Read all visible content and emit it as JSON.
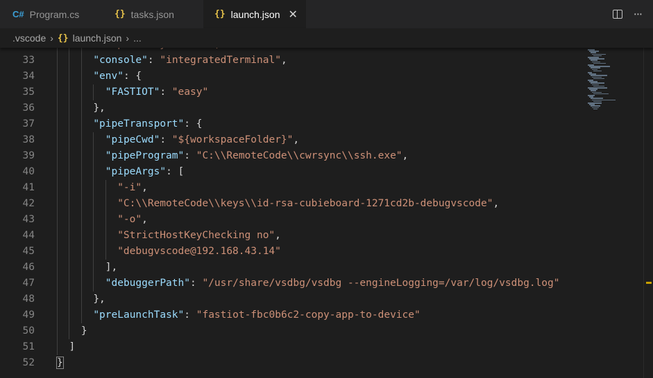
{
  "tabs": [
    {
      "label": "Program.cs",
      "icon": "C#",
      "icon_name": "csharp-file-icon",
      "active": false
    },
    {
      "label": "tasks.json",
      "icon": "{}",
      "icon_name": "json-file-icon",
      "active": false
    },
    {
      "label": "launch.json",
      "icon": "{}",
      "icon_name": "json-file-icon",
      "active": true
    }
  ],
  "tab_close": "✕",
  "tab_more": "···",
  "breadcrumb": {
    "folder": ".vscode",
    "file_icon": "{}",
    "file": "launch.json",
    "more": "..."
  },
  "colors": {
    "key": "#9cdcfe",
    "string": "#ce9178",
    "punct": "#d4d4d4",
    "background": "#1e1e1e"
  },
  "lines": [
    {
      "n": "32",
      "indent": 3,
      "tokens": [
        {
          "t": "s",
          "v": "\"stopAtEntry\": false,"
        }
      ]
    },
    {
      "n": "33",
      "indent": 3,
      "tokens": [
        {
          "t": "k",
          "v": "\"console\""
        },
        {
          "t": "p",
          "v": ": "
        },
        {
          "t": "s",
          "v": "\"integratedTerminal\""
        },
        {
          "t": "p",
          "v": ","
        }
      ]
    },
    {
      "n": "34",
      "indent": 3,
      "tokens": [
        {
          "t": "k",
          "v": "\"env\""
        },
        {
          "t": "p",
          "v": ": {"
        }
      ]
    },
    {
      "n": "35",
      "indent": 4,
      "tokens": [
        {
          "t": "k",
          "v": "\"FASTIOT\""
        },
        {
          "t": "p",
          "v": ": "
        },
        {
          "t": "s",
          "v": "\"easy\""
        }
      ]
    },
    {
      "n": "36",
      "indent": 3,
      "tokens": [
        {
          "t": "p",
          "v": "},"
        }
      ]
    },
    {
      "n": "37",
      "indent": 3,
      "tokens": [
        {
          "t": "k",
          "v": "\"pipeTransport\""
        },
        {
          "t": "p",
          "v": ": {"
        }
      ]
    },
    {
      "n": "38",
      "indent": 4,
      "tokens": [
        {
          "t": "k",
          "v": "\"pipeCwd\""
        },
        {
          "t": "p",
          "v": ": "
        },
        {
          "t": "s",
          "v": "\"${workspaceFolder}\""
        },
        {
          "t": "p",
          "v": ","
        }
      ]
    },
    {
      "n": "39",
      "indent": 4,
      "tokens": [
        {
          "t": "k",
          "v": "\"pipeProgram\""
        },
        {
          "t": "p",
          "v": ": "
        },
        {
          "t": "s",
          "v": "\"C:\\\\RemoteCode\\\\cwrsync\\\\ssh.exe\""
        },
        {
          "t": "p",
          "v": ","
        }
      ]
    },
    {
      "n": "40",
      "indent": 4,
      "tokens": [
        {
          "t": "k",
          "v": "\"pipeArgs\""
        },
        {
          "t": "p",
          "v": ": ["
        }
      ]
    },
    {
      "n": "41",
      "indent": 5,
      "tokens": [
        {
          "t": "s",
          "v": "\"-i\""
        },
        {
          "t": "p",
          "v": ","
        }
      ]
    },
    {
      "n": "42",
      "indent": 5,
      "tokens": [
        {
          "t": "s",
          "v": "\"C:\\\\RemoteCode\\\\keys\\\\id-rsa-cubieboard-1271cd2b-debugvscode\""
        },
        {
          "t": "p",
          "v": ","
        }
      ]
    },
    {
      "n": "43",
      "indent": 5,
      "tokens": [
        {
          "t": "s",
          "v": "\"-o\""
        },
        {
          "t": "p",
          "v": ","
        }
      ]
    },
    {
      "n": "44",
      "indent": 5,
      "tokens": [
        {
          "t": "s",
          "v": "\"StrictHostKeyChecking no\""
        },
        {
          "t": "p",
          "v": ","
        }
      ]
    },
    {
      "n": "45",
      "indent": 5,
      "tokens": [
        {
          "t": "s",
          "v": "\"debugvscode@192.168.43.14\""
        }
      ]
    },
    {
      "n": "46",
      "indent": 4,
      "tokens": [
        {
          "t": "p",
          "v": "],"
        }
      ]
    },
    {
      "n": "47",
      "indent": 4,
      "tokens": [
        {
          "t": "k",
          "v": "\"debuggerPath\""
        },
        {
          "t": "p",
          "v": ": "
        },
        {
          "t": "s",
          "v": "\"/usr/share/vsdbg/vsdbg --engineLogging=/var/log/vsdbg.log\""
        }
      ]
    },
    {
      "n": "48",
      "indent": 3,
      "tokens": [
        {
          "t": "p",
          "v": "},"
        }
      ]
    },
    {
      "n": "49",
      "indent": 3,
      "tokens": [
        {
          "t": "k",
          "v": "\"preLaunchTask\""
        },
        {
          "t": "p",
          "v": ": "
        },
        {
          "t": "s",
          "v": "\"fastiot-fbc0b6c2-copy-app-to-device\""
        }
      ]
    },
    {
      "n": "50",
      "indent": 2,
      "tokens": [
        {
          "t": "p",
          "v": "}"
        }
      ]
    },
    {
      "n": "51",
      "indent": 1,
      "tokens": [
        {
          "t": "p",
          "v": "]"
        }
      ]
    },
    {
      "n": "52",
      "indent": 0,
      "tokens": [
        {
          "t": "p",
          "v": "}",
          "box": true
        }
      ]
    }
  ]
}
